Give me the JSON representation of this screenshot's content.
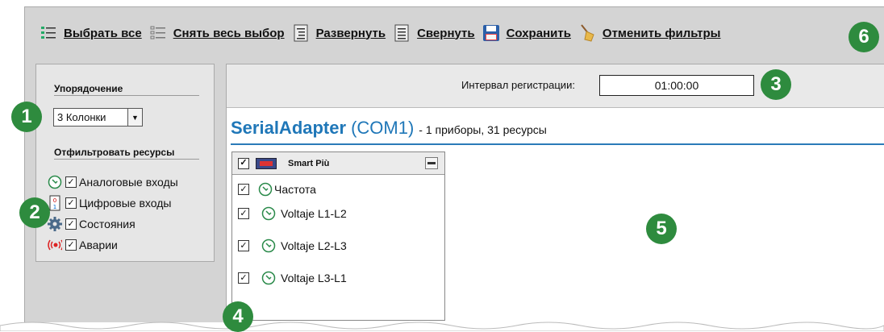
{
  "toolbar": {
    "select_all": "Выбрать все",
    "deselect_all": "Снять весь выбор",
    "expand": "Развернуть",
    "collapse": "Свернуть",
    "save": "Сохранить",
    "cancel_filters": "Отменить фильтры"
  },
  "badges": [
    "1",
    "2",
    "3",
    "4",
    "5",
    "6"
  ],
  "sort": {
    "heading": "Упорядочение",
    "selected": "3 Колонки"
  },
  "filter": {
    "heading": "Отфильтровать ресурсы",
    "items": [
      {
        "label": "Аналоговые входы",
        "checked": true,
        "icon": "analog-icon"
      },
      {
        "label": "Цифровые входы",
        "checked": true,
        "icon": "digital-icon"
      },
      {
        "label": "Состояния",
        "checked": true,
        "icon": "gear-icon"
      },
      {
        "label": "Аварии",
        "checked": true,
        "icon": "alarm-icon"
      }
    ]
  },
  "interval": {
    "label": "Интервал регистрации:",
    "value": "01:00:00"
  },
  "adapter": {
    "name": "SerialAdapter",
    "port": "(COM1)",
    "info": "- 1 приборы, 31 ресурсы"
  },
  "device": {
    "name": "Smart Più",
    "resources": [
      {
        "label": "Частота",
        "checked": true
      },
      {
        "label": "Voltaje L1-L2",
        "checked": true
      },
      {
        "label": "Voltaje L2-L3",
        "checked": true
      },
      {
        "label": "Voltaje L3-L1",
        "checked": true
      }
    ]
  },
  "colors": {
    "badge": "#2e8b3e",
    "accent": "#1f77b8"
  }
}
